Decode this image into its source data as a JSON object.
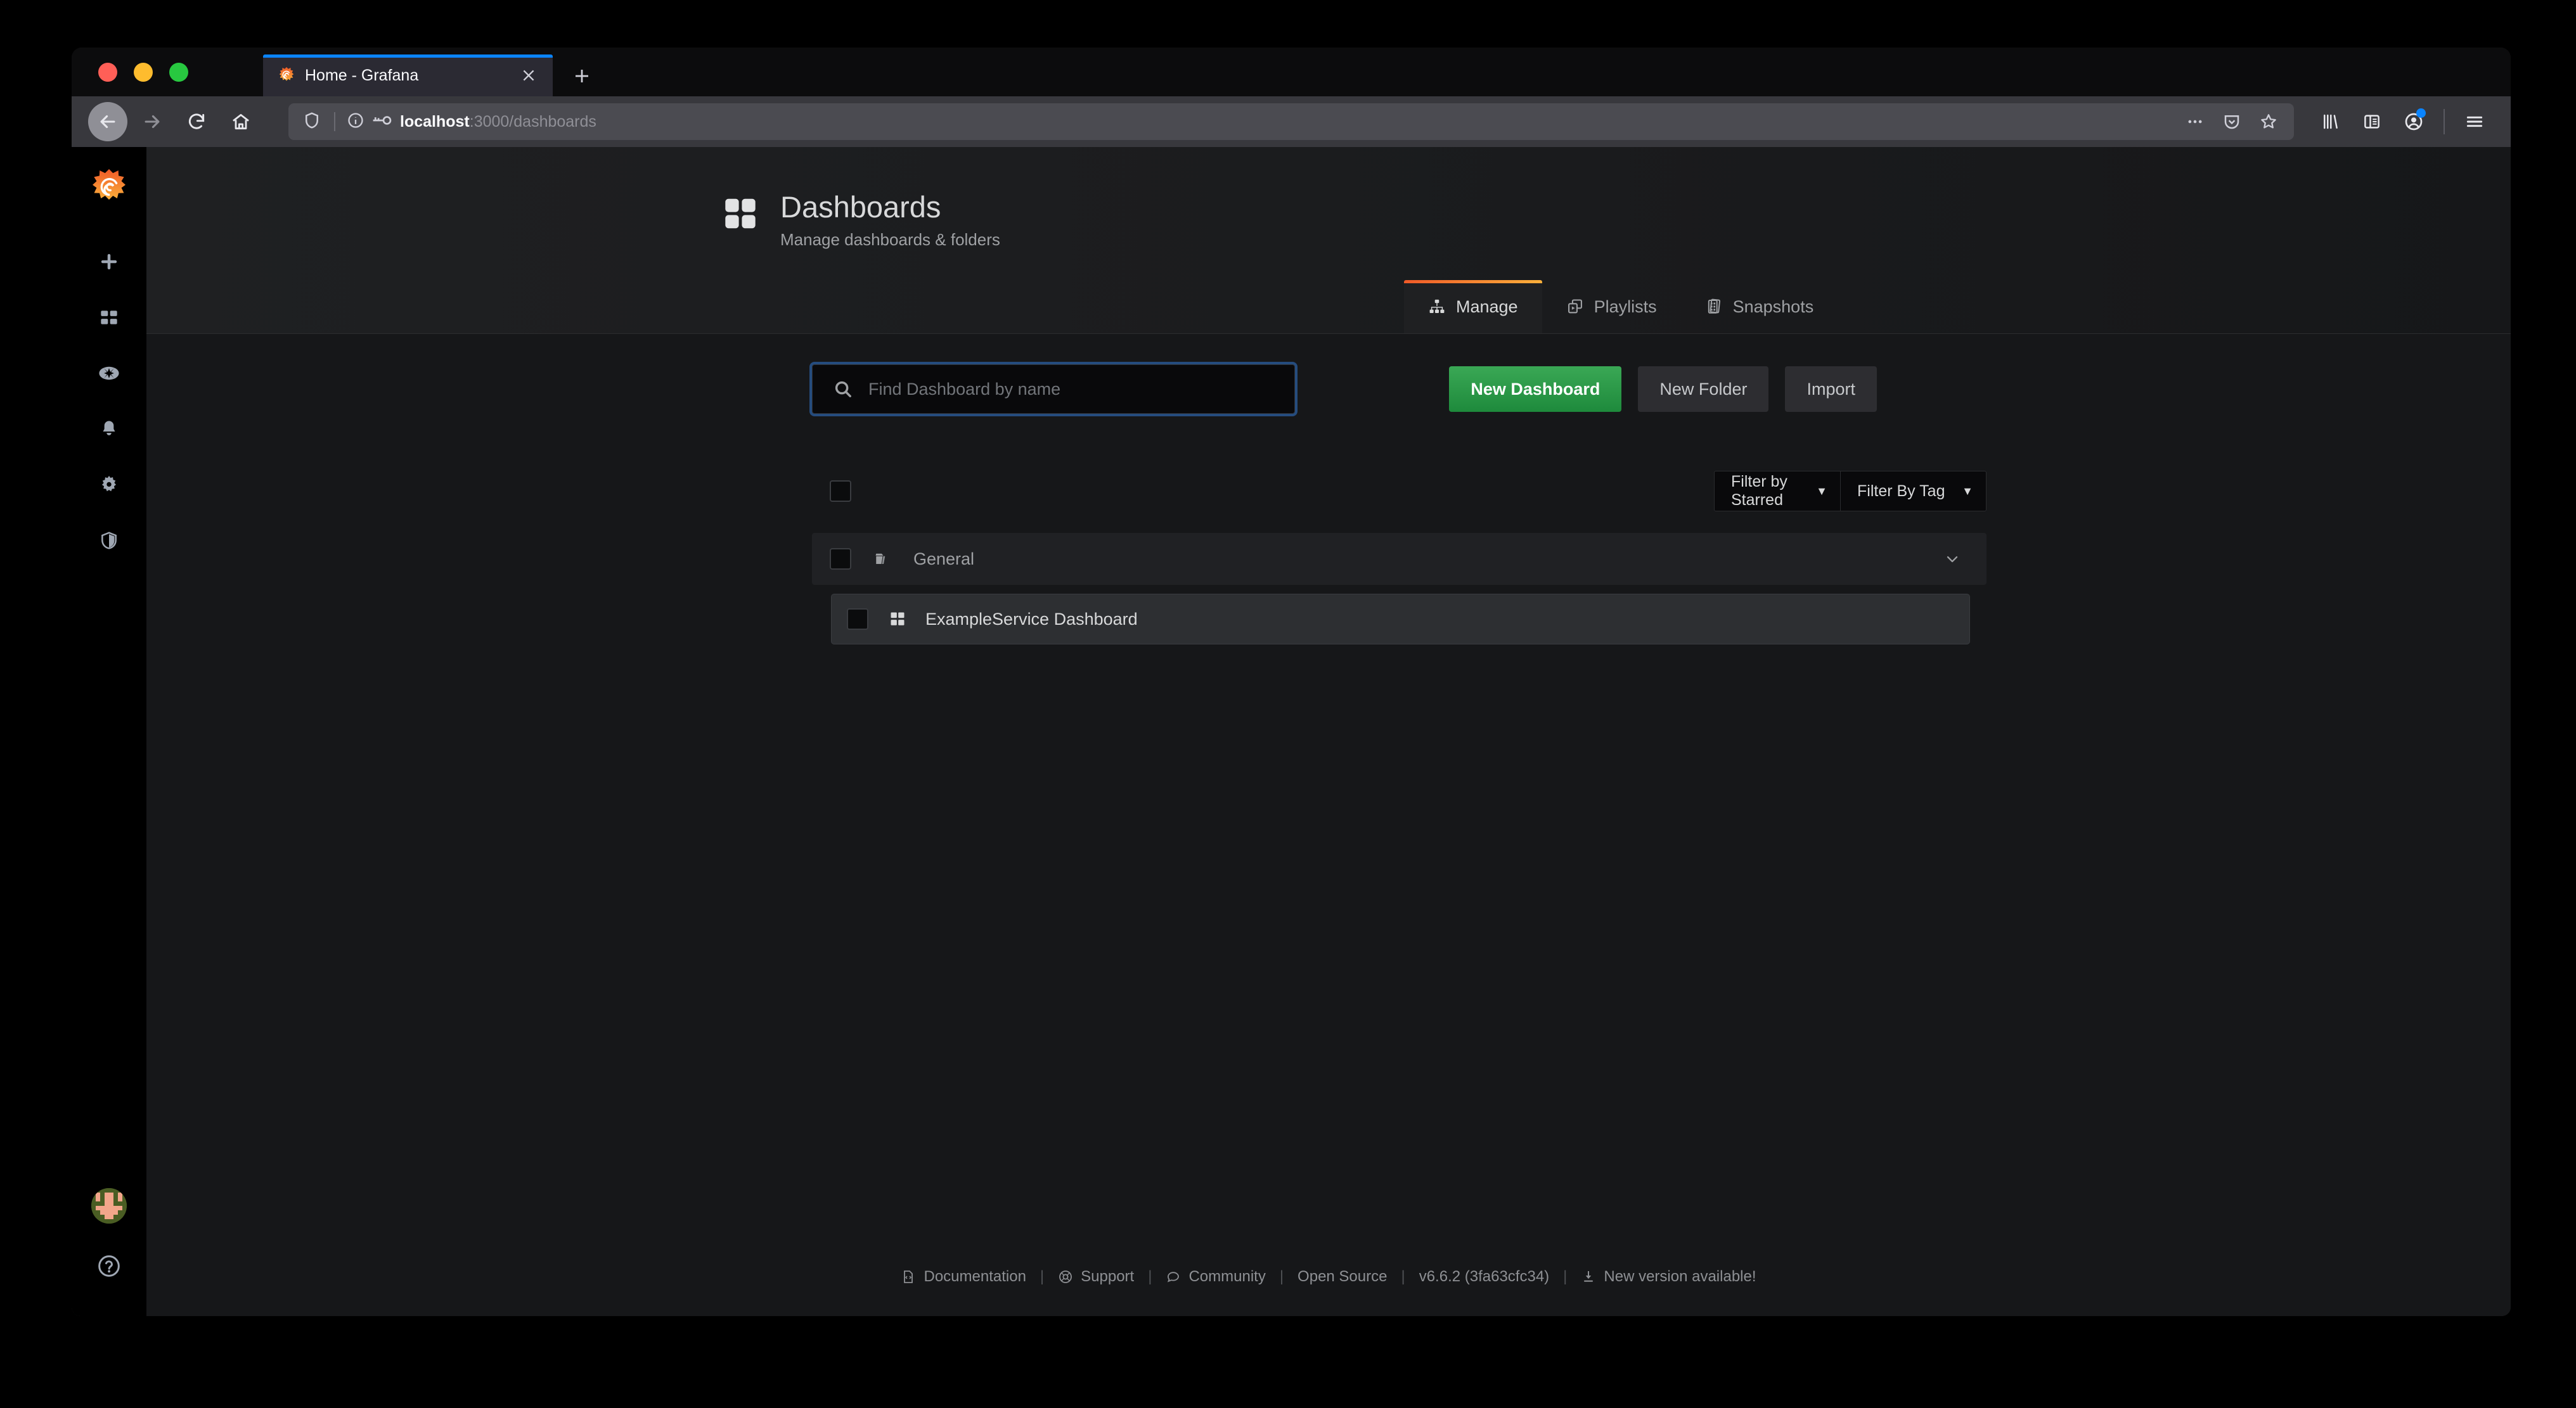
{
  "browser": {
    "tab": {
      "title": "Home - Grafana",
      "favicon": "grafana-logo-icon",
      "close_label": "×"
    },
    "new_tab_label": "+",
    "url": {
      "host": "localhost",
      "path": ":3000/dashboards",
      "full": "localhost:3000/dashboards"
    },
    "nav": {
      "back": "back-arrow-icon",
      "forward": "forward-arrow-icon",
      "reload": "reload-icon",
      "home": "home-icon"
    },
    "url_icons": [
      "ellipsis-icon",
      "pocket-icon",
      "bookmark-star-icon"
    ],
    "toolbar_icons": [
      "library-icon",
      "sidebar-icon",
      "account-icon",
      "hamburger-menu-icon"
    ],
    "account_badge_color": "#0a84ff"
  },
  "sidebar": {
    "brand": "grafana-logo-icon",
    "items": [
      {
        "name": "create",
        "icon": "plus-icon"
      },
      {
        "name": "dashboards",
        "icon": "apps-grid-icon"
      },
      {
        "name": "explore",
        "icon": "compass-icon"
      },
      {
        "name": "alerting",
        "icon": "bell-icon"
      },
      {
        "name": "configuration",
        "icon": "gear-icon"
      },
      {
        "name": "server-admin",
        "icon": "shield-icon"
      }
    ],
    "bottom": [
      {
        "name": "user-avatar",
        "icon": "avatar-identicon"
      },
      {
        "name": "help",
        "icon": "question-circle-icon"
      }
    ]
  },
  "page": {
    "title": "Dashboards",
    "subtitle": "Manage dashboards & folders",
    "icon": "apps-grid-icon"
  },
  "tabs": [
    {
      "label": "Manage",
      "icon": "sitemap-icon",
      "active": true
    },
    {
      "label": "Playlists",
      "icon": "playlist-icon",
      "active": false
    },
    {
      "label": "Snapshots",
      "icon": "snapshots-icon",
      "active": false
    }
  ],
  "toolbar": {
    "search_placeholder": "Find Dashboard by name",
    "search_value": "",
    "new_dashboard_label": "New Dashboard",
    "new_folder_label": "New Folder",
    "import_label": "Import"
  },
  "filters": {
    "starred_label": "Filter by Starred",
    "tag_label": "Filter By Tag"
  },
  "list": {
    "folder": {
      "label": "General",
      "icon": "folder-open-icon",
      "chevron": "chevron-down-icon"
    },
    "dashboards": [
      {
        "label": "ExampleService Dashboard",
        "icon": "apps-grid-icon"
      }
    ]
  },
  "footer": {
    "links": [
      {
        "label": "Documentation",
        "icon": "doc-icon"
      },
      {
        "label": "Support",
        "icon": "support-icon"
      },
      {
        "label": "Community",
        "icon": "community-icon"
      },
      {
        "label": "Open Source",
        "icon": ""
      }
    ],
    "version": "v6.6.2 (3fa63cfc34)",
    "update": {
      "label": "New version available!",
      "icon": "download-icon"
    },
    "separator": "|"
  },
  "colors": {
    "accent_orange": "#f05a28",
    "accent_yellow": "#fbb03b",
    "primary_green": "#1e8a3c",
    "focus_blue": "#3378d1",
    "page_bg": "#161719",
    "panel_bg": "#1f2022"
  }
}
